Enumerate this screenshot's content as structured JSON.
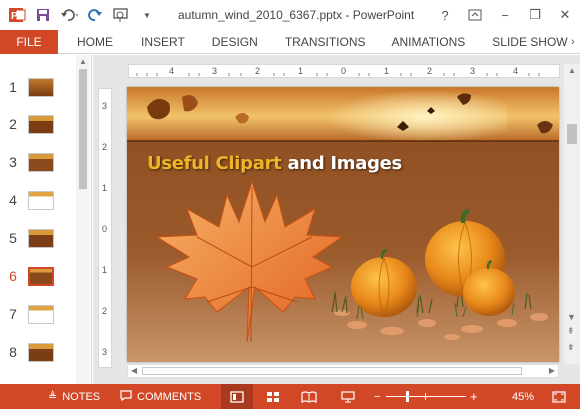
{
  "titlebar": {
    "title": "autumn_wind_2010_6367.pptx - PowerPoint",
    "app_icon": "powerpoint-icon",
    "qat": [
      "save-icon",
      "undo-icon",
      "redo-icon",
      "start-from-beginning-icon"
    ],
    "controls": {
      "help": "?",
      "minimize": "−",
      "restore": "❐",
      "close": "✕"
    }
  },
  "ribbon": {
    "file": "FILE",
    "tabs": [
      "HOME",
      "INSERT",
      "DESIGN",
      "TRANSITIONS",
      "ANIMATIONS",
      "SLIDE SHOW"
    ]
  },
  "thumbnails": {
    "numbers": [
      "1",
      "2",
      "3",
      "4",
      "5",
      "6",
      "7",
      "8"
    ],
    "active": "6"
  },
  "ruler": {
    "horizontal": [
      "4",
      "3",
      "2",
      "1",
      "0",
      "1",
      "2",
      "3",
      "4"
    ],
    "vertical": [
      "3",
      "2",
      "1",
      "0",
      "1",
      "2",
      "3"
    ]
  },
  "slide": {
    "title_highlight": "Useful Clipart",
    "title_rest": "and Images"
  },
  "statusbar": {
    "notes": "NOTES",
    "comments": "COMMENTS",
    "zoom_out": "−",
    "zoom_in": "+",
    "zoom": "45%",
    "zoom_level": 0.45
  },
  "colors": {
    "accent": "#d24726",
    "slide_bg": "#8a4a1e",
    "title_gold": "#f0b429"
  }
}
